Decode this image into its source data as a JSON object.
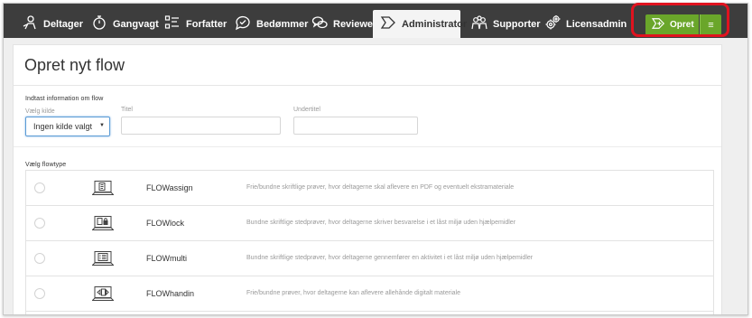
{
  "colors": {
    "nav_background": "#3d3d3d",
    "accent_green": "#6aa62a",
    "highlight_red": "#e0131f"
  },
  "navbar": {
    "items": [
      {
        "label": "Deltager",
        "icon": "participant-icon"
      },
      {
        "label": "Gangvagt",
        "icon": "stopwatch-icon"
      },
      {
        "label": "Forfatter",
        "icon": "checklist-icon"
      },
      {
        "label": "Bedømmer",
        "icon": "speech-bubble-check-icon"
      },
      {
        "label": "Reviewer",
        "icon": "speech-bubbles-icon"
      },
      {
        "label": "Administrator",
        "icon": "flow-arrow-icon"
      },
      {
        "label": "Supporter",
        "icon": "group-icon"
      },
      {
        "label": "Licensadmin",
        "icon": "gears-icon"
      }
    ],
    "active": "Administrator",
    "create_button": {
      "label": "Opret",
      "icon": "flow-arrow-icon"
    },
    "menu_button": {
      "icon": "hamburger-icon"
    }
  },
  "page": {
    "title": "Opret nyt flow",
    "info_section_label": "Indtast information om flow",
    "source": {
      "label": "Vælg kilde",
      "selected": "Ingen kilde valgt"
    },
    "title_field": {
      "label": "Titel",
      "value": ""
    },
    "subtitle_field": {
      "label": "Undertitel",
      "value": ""
    },
    "flowtype_label": "Vælg flowtype",
    "flow_types": [
      {
        "name": "FLOWassign",
        "description": "Frie/bundne skriftlige prøver, hvor deltagerne skal aflevere en PDF og eventuelt ekstramateriale",
        "icon": "laptop-document-icon"
      },
      {
        "name": "FLOWlock",
        "description": "Bundne skriftlige stedprøver, hvor deltagerne skriver besvarelse i et låst miljø uden hjælpemidler",
        "icon": "laptop-lock-icon"
      },
      {
        "name": "FLOWmulti",
        "description": "Bundne skriftlige stedprøver, hvor deltagerne gennemfører en aktivitet i et låst miljø uden hjælpemidler",
        "icon": "laptop-list-icon"
      },
      {
        "name": "FLOWhandin",
        "description": "Frie/bundne prøver, hvor deltagerne kan aflevere allehånde digitalt materiale",
        "icon": "laptop-handin-icon"
      }
    ]
  }
}
